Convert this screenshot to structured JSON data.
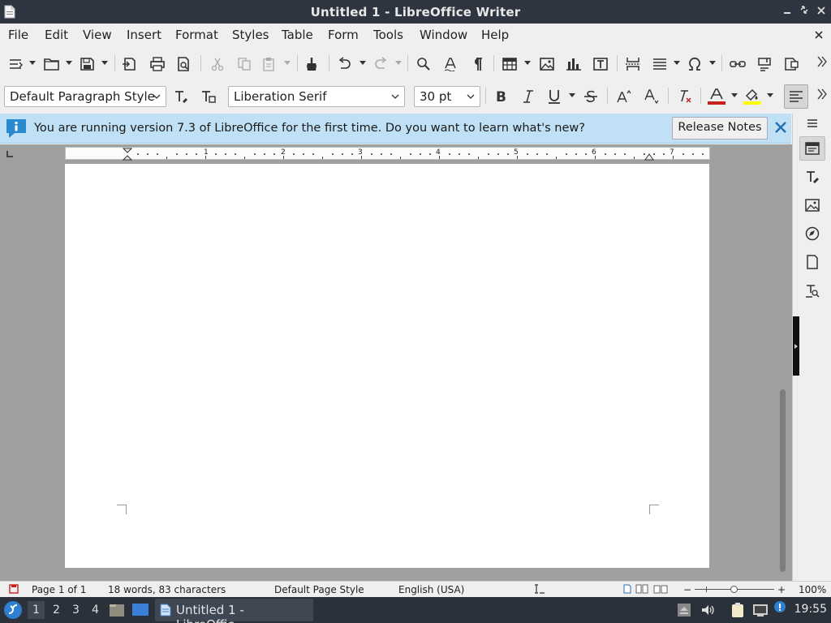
{
  "window": {
    "title": "Untitled 1 - LibreOffice Writer"
  },
  "menu": {
    "items": [
      "File",
      "Edit",
      "View",
      "Insert",
      "Format",
      "Styles",
      "Table",
      "Form",
      "Tools",
      "Window",
      "Help"
    ]
  },
  "format_toolbar": {
    "paragraph_style": "Default Paragraph Style",
    "font_name": "Liberation Serif",
    "font_size": "30 pt"
  },
  "infobar": {
    "message": "You are running version 7.3 of LibreOffice for the first time. Do you want to learn what's new?",
    "button_label": "Release Notes"
  },
  "ruler": {
    "labels": [
      "1",
      "2",
      "3",
      "4",
      "5",
      "6",
      "7"
    ]
  },
  "status": {
    "page": "Page 1 of 1",
    "words": "18 words, 83 characters",
    "page_style": "Default Page Style",
    "language": "English (USA)",
    "zoom": "100%",
    "zoom_minus": "−",
    "zoom_plus": "+"
  },
  "taskbar": {
    "workspaces": [
      "1",
      "2",
      "3",
      "4"
    ],
    "active_task": "Untitled 1 - LibreOffic...",
    "clock": "19:55"
  },
  "icons": {
    "titlebar": [
      "document-icon",
      "minimize-icon",
      "maximize-icon",
      "close-icon"
    ],
    "standard_toolbar": [
      "new-document-icon",
      "open-icon",
      "save-icon",
      "export-pdf-icon",
      "print-icon",
      "print-preview-icon",
      "cut-icon",
      "copy-icon",
      "paste-icon",
      "clone-formatting-icon",
      "undo-icon",
      "redo-icon",
      "find-replace-icon",
      "spelling-icon",
      "formatting-marks-icon",
      "insert-table-icon",
      "insert-image-icon",
      "insert-chart-icon",
      "insert-textbox-icon",
      "page-break-icon",
      "insert-field-icon",
      "special-character-icon",
      "hyperlink-icon",
      "footnote-icon",
      "comment-icon"
    ],
    "sidebar": [
      "properties-icon",
      "styles-icon",
      "gallery-icon",
      "navigator-icon",
      "page-icon",
      "manage-changes-icon"
    ]
  },
  "colors": {
    "accent": "#2e3540",
    "infobar_bg": "#bfe0f5",
    "font_color": "#c9211e",
    "highlight_color": "#ffff00"
  }
}
